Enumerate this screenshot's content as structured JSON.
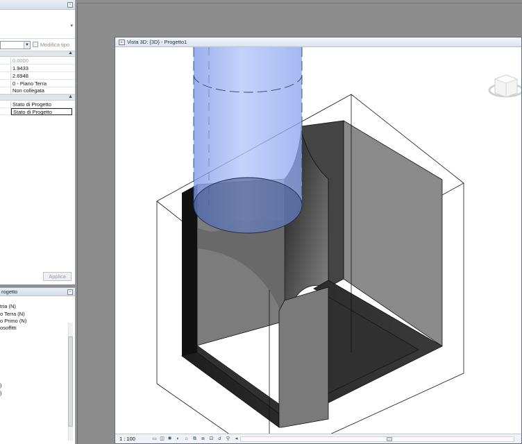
{
  "properties": {
    "edit_type_label": "Modifica tipo",
    "rows": [
      {
        "value": "0.0000",
        "muted": true
      },
      {
        "value": "1.9433",
        "muted": false
      },
      {
        "value": "2.6948",
        "muted": false
      },
      {
        "value": "0 - Piano Terra",
        "muted": false
      },
      {
        "value": "Non collegata",
        "muted": false
      }
    ],
    "phase_rows": [
      {
        "value": "Stato di Progetto"
      },
      {
        "value": "Stato di Progetto"
      }
    ],
    "apply_label": "Applica"
  },
  "project_browser": {
    "title": "rogetto",
    "items": [
      "tria (N)",
      "o Terra (N)",
      "o Primo (N)",
      "osoffitti",
      ")",
      ")"
    ]
  },
  "view": {
    "title": "Vista 3D: {3D} - Progetto1",
    "scale": "1 : 100"
  },
  "colors": {
    "void_fill": "#8da8f0",
    "solid_dark": "#111111",
    "solid_gray": "#4e4e4e",
    "face_light": "#858585"
  }
}
